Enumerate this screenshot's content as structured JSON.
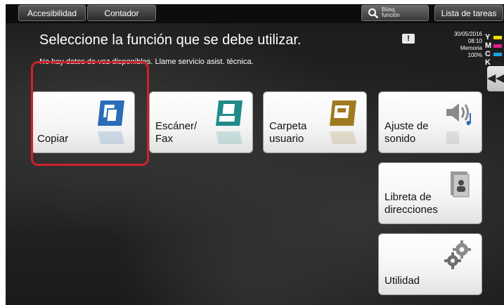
{
  "topbar": {
    "accessibility_label": "Accesibilidad",
    "counter_label": "Contador",
    "search_label_line1": "Búsq.",
    "search_label_line2": "función",
    "task_list_label": "Lista de tareas"
  },
  "header": {
    "title": "Seleccione la función que se debe utilizar.",
    "message": "No hay datos de voz disponibles. Llame servicio asist. técnica.",
    "warning_icon_glyph": "!"
  },
  "status": {
    "date": "30/05/2016",
    "time": "08:10",
    "memory_label": "Memoria",
    "memory_value": "100%"
  },
  "toner": [
    {
      "letter": "Y",
      "color": "#f3e000"
    },
    {
      "letter": "M",
      "color": "#e0208a"
    },
    {
      "letter": "C",
      "color": "#1ea0e0"
    },
    {
      "letter": "K",
      "color": "#222222"
    }
  ],
  "collapse_glyph": "◀◀",
  "tiles": {
    "copy": {
      "label": "Copiar",
      "icon": "copy-icon",
      "color": "#2a6cb8"
    },
    "scan_fax": {
      "label": "Escáner/\nFax",
      "icon": "scan-fax-icon",
      "color": "#1f8a8a"
    },
    "user_box": {
      "label": "Carpeta\nusuario",
      "icon": "user-box-icon",
      "color": "#a07a20"
    },
    "sound": {
      "label": "Ajuste de\nsonido",
      "icon": "speaker-icon",
      "color": "#888888"
    },
    "address_book": {
      "label": "Libreta de\ndirecciones",
      "icon": "address-book-icon",
      "color": "#888888"
    },
    "utility": {
      "label": "Utilidad",
      "icon": "gear-icon",
      "color": "#888888"
    }
  }
}
